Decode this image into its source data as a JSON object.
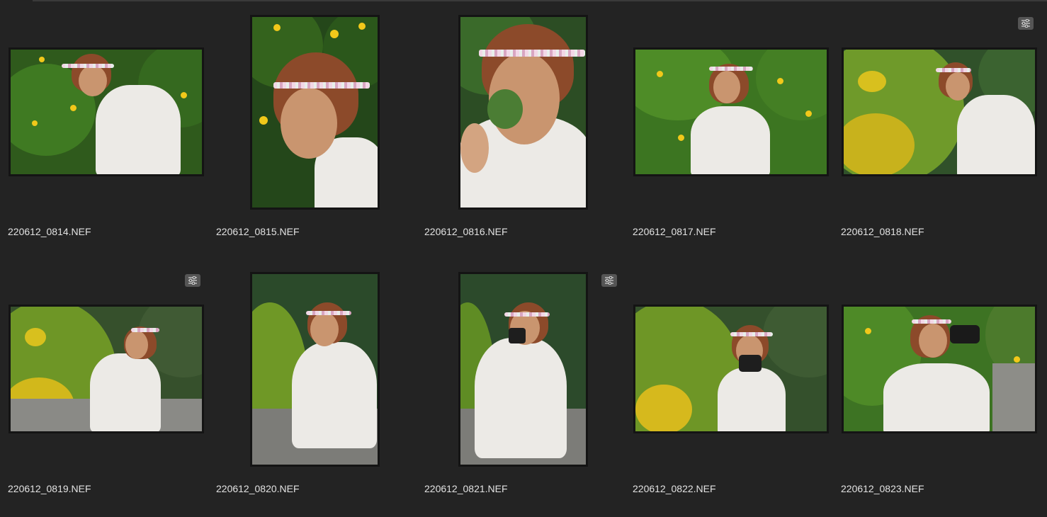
{
  "grid": {
    "items": [
      {
        "filename": "220612_0814.NEF",
        "adjusted": false
      },
      {
        "filename": "220612_0815.NEF",
        "adjusted": false
      },
      {
        "filename": "220612_0816.NEF",
        "adjusted": false
      },
      {
        "filename": "220612_0817.NEF",
        "adjusted": false
      },
      {
        "filename": "220612_0818.NEF",
        "adjusted": true
      },
      {
        "filename": "220612_0819.NEF",
        "adjusted": true
      },
      {
        "filename": "220612_0820.NEF",
        "adjusted": false
      },
      {
        "filename": "220612_0821.NEF",
        "adjusted": true
      },
      {
        "filename": "220612_0822.NEF",
        "adjusted": false
      },
      {
        "filename": "220612_0823.NEF",
        "adjusted": false
      }
    ]
  },
  "icons": {
    "adjustment_badge": "sliders-icon"
  },
  "colors": {
    "background": "#232323",
    "thumb_border": "#141414",
    "filename_text": "#e2e2e2",
    "badge": "#555555"
  }
}
